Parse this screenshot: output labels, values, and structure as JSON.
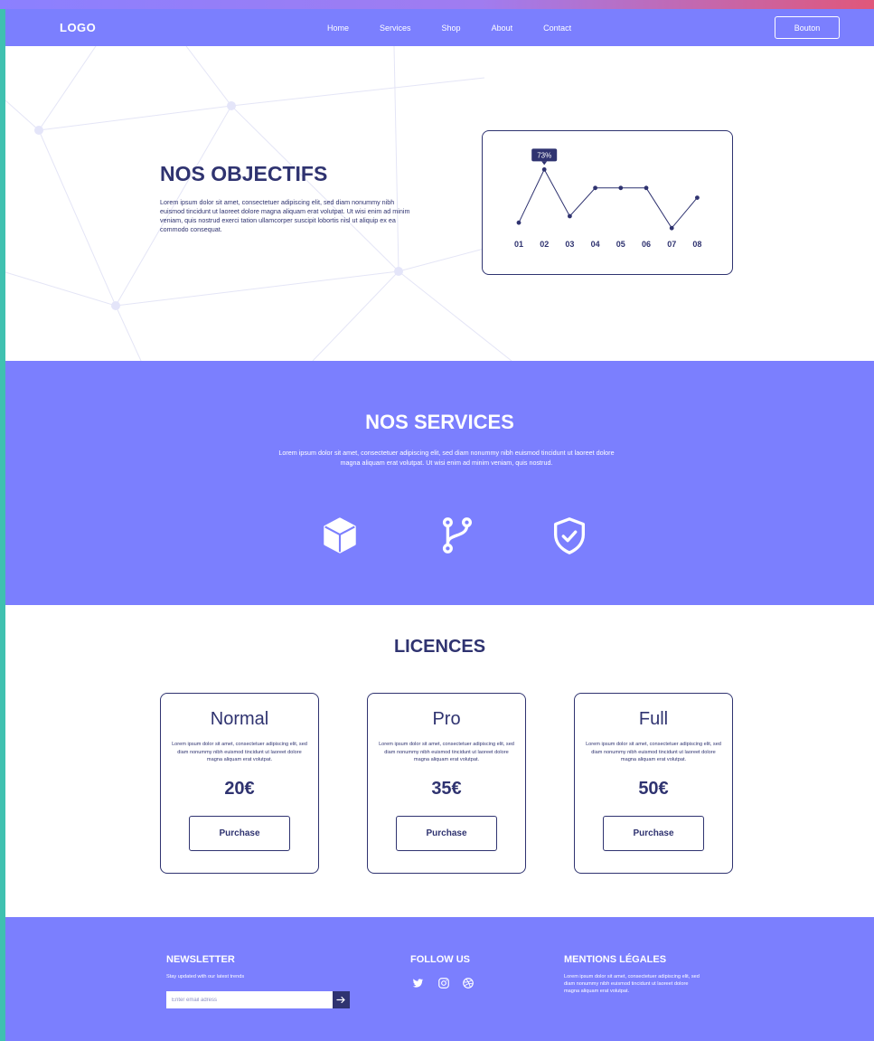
{
  "nav": {
    "logo": "LOGO",
    "links": [
      "Home",
      "Services",
      "Shop",
      "About",
      "Contact"
    ],
    "button": "Bouton"
  },
  "hero": {
    "title": "NOS OBJECTIFS",
    "text": "Lorem ipsum dolor sit amet, consectetuer adipiscing elit, sed diam nonummy nibh euismod tincidunt ut laoreet dolore magna aliquam erat volutpat. Ut wisi enim ad minim veniam, quis nostrud exerci tation ullamcorper suscipit lobortis nisl ut aliquip ex ea commodo consequat."
  },
  "chart_data": {
    "type": "line",
    "categories": [
      "01",
      "02",
      "03",
      "04",
      "05",
      "06",
      "07",
      "08"
    ],
    "values": [
      24,
      73,
      30,
      56,
      56,
      56,
      19,
      47
    ],
    "highlight": {
      "category": "02",
      "label": "73%"
    },
    "ylim": [
      0,
      100
    ],
    "grid": false
  },
  "services": {
    "title": "NOS SERVICES",
    "text": "Lorem ipsum dolor sit amet, consectetuer adipiscing elit, sed diam nonummy nibh euismod tincidunt ut laoreet dolore magna aliquam erat volutpat. Ut wisi enim ad minim veniam, quis nostrud.",
    "icons": [
      "cube-icon",
      "git-branch-icon",
      "shield-check-icon"
    ]
  },
  "licences": {
    "title": "LICENCES",
    "cards": [
      {
        "name": "Normal",
        "text": "Lorem ipsum dolor sit amet, consectetuer adipiscing elit, sed diam nonummy nibh euismod tincidunt ut laoreet dolore magna aliquam erat volutpat.",
        "price": "20€",
        "button": "Purchase"
      },
      {
        "name": "Pro",
        "text": "Lorem ipsum dolor sit amet, consectetuer adipiscing elit, sed diam nonummy nibh euismod tincidunt ut laoreet dolore magna aliquam erat volutpat.",
        "price": "35€",
        "button": "Purchase"
      },
      {
        "name": "Full",
        "text": "Lorem ipsum dolor sit amet, consectetuer adipiscing elit, sed diam nonummy nibh euismod tincidunt ut laoreet dolore magna aliquam erat volutpat.",
        "price": "50€",
        "button": "Purchase"
      }
    ]
  },
  "footer": {
    "newsletter": {
      "title": "NEWSLETTER",
      "subtitle": "Stay updated with our latest trends",
      "placeholder": "Enter email adress"
    },
    "follow": {
      "title": "FOLLOW US",
      "icons": [
        "twitter-icon",
        "instagram-icon",
        "dribbble-icon"
      ]
    },
    "legal": {
      "title": "MENTIONS LÉGALES",
      "text": "Lorem ipsum dolor sit amet, consectetuer adipiscing elit, sed diam nonummy nibh euismod tincidunt ut laoreet dolore magna aliquam erat volutpat."
    }
  },
  "colors": {
    "primary": "#7b7ffe",
    "dark": "#2f3370",
    "accent_left": "#3fc1b0"
  }
}
